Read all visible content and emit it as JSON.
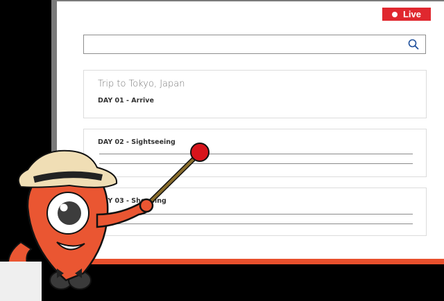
{
  "live_badge": {
    "label": "Live"
  },
  "search": {
    "placeholder": "",
    "icon": "search-icon"
  },
  "itinerary": {
    "title": "Trip to Tokyo, Japan",
    "days": [
      {
        "label": "DAY 01 - Arrive"
      },
      {
        "label": "DAY 02 - Sightseeing"
      },
      {
        "label": "DAY 03 - Shopping"
      }
    ]
  },
  "colors": {
    "live_red": "#e0282f",
    "mascot_orange": "#ea5632",
    "pointer_red": "#d7141b",
    "accent_bar": "#e8502d"
  }
}
